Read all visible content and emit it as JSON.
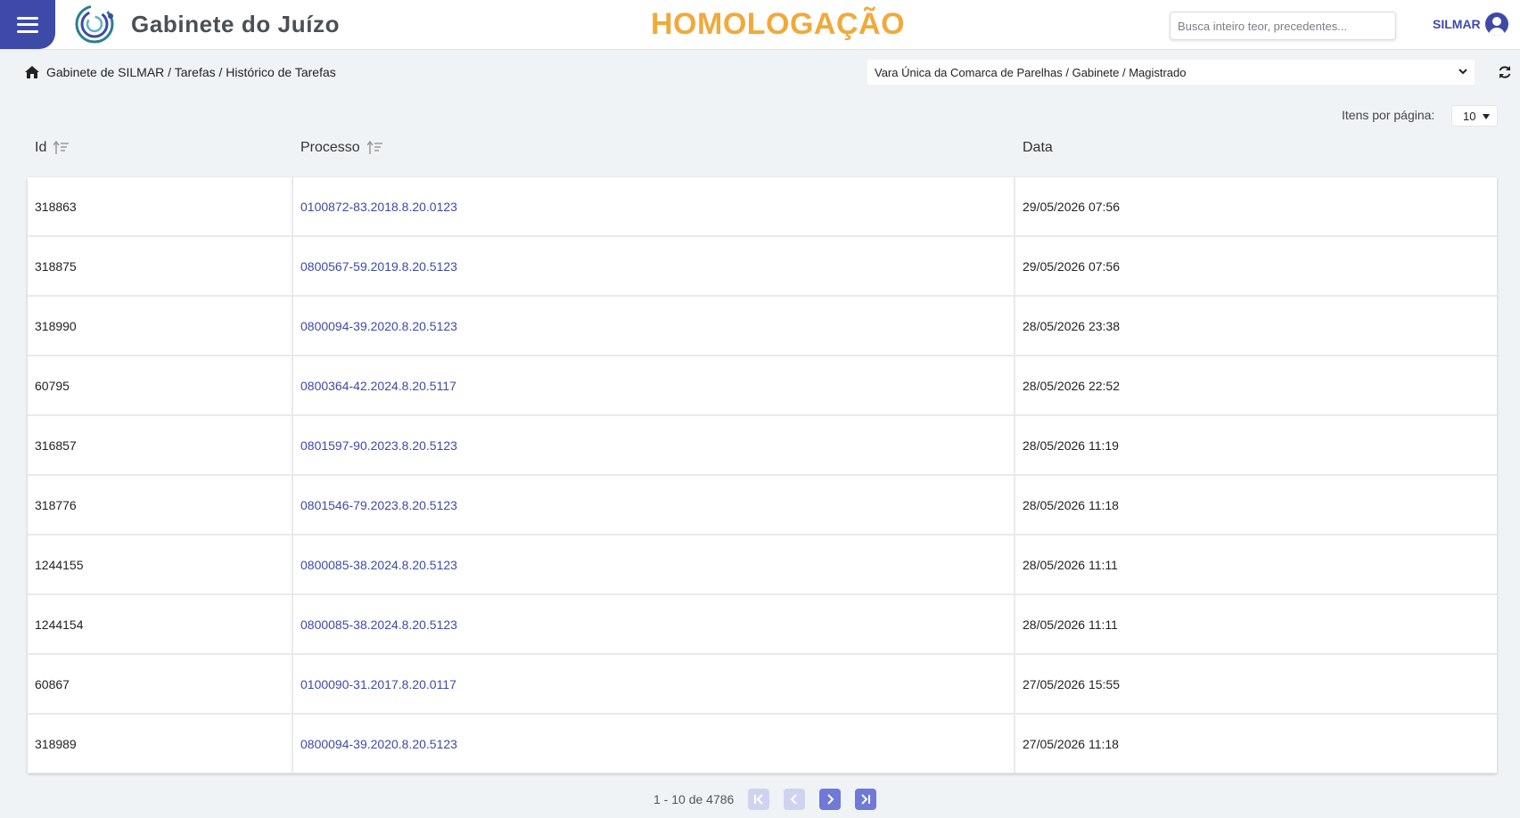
{
  "header": {
    "app_title": "Gabinete do Juízo",
    "environment": "HOMOLOGAÇÃO",
    "search_placeholder": "Busca inteiro teor, precedentes...",
    "search_value": "",
    "user_name": "SILMAR"
  },
  "breadcrumb": {
    "path": "Gabinete de SILMAR / Tarefas / Histórico de Tarefas"
  },
  "unit_selector": {
    "selected": "Vara Única da Comarca de Parelhas / Gabinete / Magistrado"
  },
  "page_size": {
    "label": "Itens por página:",
    "value": "10"
  },
  "table": {
    "columns": [
      "Id",
      "Processo",
      "Data"
    ],
    "rows": [
      {
        "id": "318863",
        "processo": "0100872-83.2018.8.20.0123",
        "data": "29/05/2026 07:56"
      },
      {
        "id": "318875",
        "processo": "0800567-59.2019.8.20.5123",
        "data": "29/05/2026 07:56"
      },
      {
        "id": "318990",
        "processo": "0800094-39.2020.8.20.5123",
        "data": "28/05/2026 23:38"
      },
      {
        "id": "60795",
        "processo": "0800364-42.2024.8.20.5117",
        "data": "28/05/2026 22:52"
      },
      {
        "id": "316857",
        "processo": "0801597-90.2023.8.20.5123",
        "data": "28/05/2026 11:19"
      },
      {
        "id": "318776",
        "processo": "0801546-79.2023.8.20.5123",
        "data": "28/05/2026 11:18"
      },
      {
        "id": "1244155",
        "processo": "0800085-38.2024.8.20.5123",
        "data": "28/05/2026 11:11"
      },
      {
        "id": "1244154",
        "processo": "0800085-38.2024.8.20.5123",
        "data": "28/05/2026 11:11"
      },
      {
        "id": "60867",
        "processo": "0100090-31.2017.8.20.0117",
        "data": "27/05/2026 15:55"
      },
      {
        "id": "318989",
        "processo": "0800094-39.2020.8.20.5123",
        "data": "27/05/2026 11:18"
      }
    ]
  },
  "pagination": {
    "range_label": "1 - 10 de 4786"
  },
  "colors": {
    "primary": "#3d4aa8",
    "environment": "#f0a93b",
    "background": "#f0f3f6"
  },
  "icons": [
    "menu-icon",
    "logo-icon",
    "user-icon",
    "home-icon",
    "chevron-down-icon",
    "refresh-icon",
    "sort-icon",
    "first-page-icon",
    "prev-page-icon",
    "next-page-icon",
    "last-page-icon"
  ]
}
